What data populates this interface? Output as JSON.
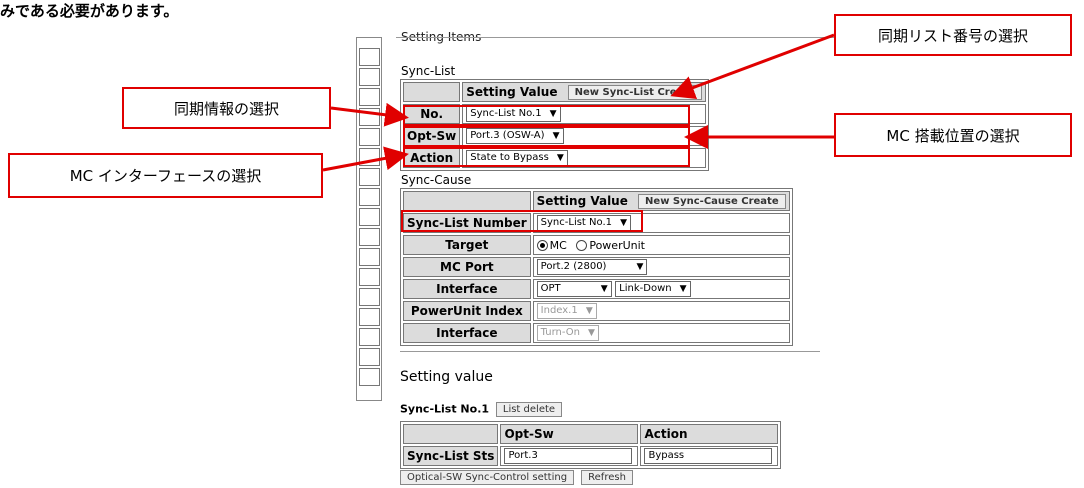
{
  "top_note": "みである必要があります。",
  "setting_items_title": "Setting Items",
  "sync_list": {
    "title": "Sync-List",
    "header_value": "Setting Value",
    "create_button": "New Sync-List Create",
    "rows": [
      {
        "label": "No.",
        "value": "Sync-List No.1"
      },
      {
        "label": "Opt-Sw",
        "value": "Port.3 (OSW-A)"
      },
      {
        "label": "Action",
        "value": "State to Bypass"
      }
    ]
  },
  "sync_cause": {
    "title": "Sync-Cause",
    "header_value": "Setting Value",
    "create_button": "New Sync-Cause Create",
    "list_number_label": "Sync-List Number",
    "list_number_value": "Sync-List No.1",
    "target_label": "Target",
    "target_options": [
      "MC",
      "PowerUnit"
    ],
    "mc_port_label": "MC Port",
    "mc_port_value": "Port.2 (2800)",
    "interface_label": "Interface",
    "interface_value": "OPT",
    "interface_event": "Link-Down",
    "powerunit_label": "PowerUnit Index",
    "powerunit_value": "Index.1",
    "interface2_label": "Interface",
    "interface2_value": "Turn-On"
  },
  "setting_value": {
    "title": "Setting value",
    "list_name": "Sync-List No.1",
    "delete_button": "List delete",
    "col_optsw": "Opt-Sw",
    "col_action": "Action",
    "row_label": "Sync-List Sts",
    "optsw_value": "Port.3",
    "action_value": "Bypass",
    "sync_button": "Optical-SW Sync-Control setting",
    "refresh_button": "Refresh"
  },
  "callouts": {
    "list_number": "同期リスト番号の選択",
    "sync_info": "同期情報の選択",
    "mc_position": "MC 搭載位置の選択",
    "mc_interface": "MC インターフェースの選択"
  },
  "accent_color": "#e00000"
}
